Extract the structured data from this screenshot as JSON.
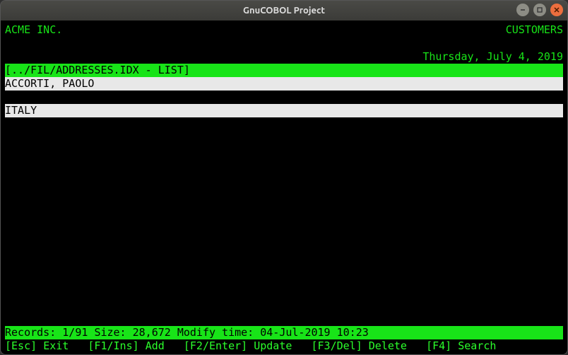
{
  "window": {
    "title": "GnuCOBOL Project"
  },
  "header": {
    "company": "ACME INC.",
    "module": "CUSTOMERS",
    "date": "Thursday, July 4, 2019"
  },
  "context_bar": "[../FIL/ADDRESSES.IDX - LIST]",
  "record": {
    "name": "ACCORTI, PAOLO",
    "country": "ITALY"
  },
  "status": {
    "records_label": "Records:",
    "records_value": "1/91",
    "size_label": "Size:",
    "size_value": "28,672",
    "mtime_label": "Modify time:",
    "mtime_value": "04-Jul-2019 10:23"
  },
  "fkeys": {
    "esc": {
      "key": "[Esc]",
      "label": "Exit"
    },
    "f1": {
      "key": "[F1/Ins]",
      "label": "Add"
    },
    "f2": {
      "key": "[F2/Enter]",
      "label": "Update"
    },
    "f3": {
      "key": "[F3/Del]",
      "label": "Delete"
    },
    "f4": {
      "key": "[F4]",
      "label": "Search"
    }
  }
}
